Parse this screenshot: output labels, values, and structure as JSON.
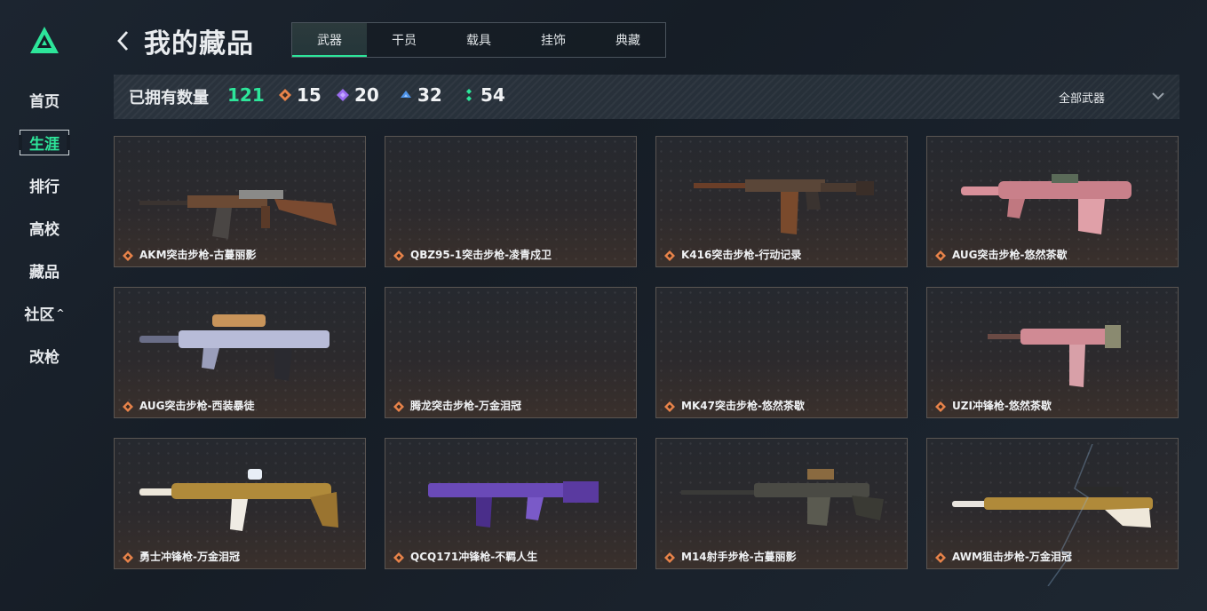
{
  "sidebar": {
    "logo_icon": "triangle-logo",
    "items": [
      {
        "label": "首页",
        "active": false
      },
      {
        "label": "生涯",
        "active": true
      },
      {
        "label": "排行",
        "active": false
      },
      {
        "label": "高校",
        "active": false
      },
      {
        "label": "藏品",
        "active": false
      },
      {
        "label": "社区",
        "active": false,
        "caret": "^"
      },
      {
        "label": "改枪",
        "active": false
      }
    ]
  },
  "header": {
    "title": "我的藏品",
    "back_icon": "chevron-left-icon"
  },
  "tabs": [
    {
      "label": "武器",
      "active": true
    },
    {
      "label": "干员",
      "active": false
    },
    {
      "label": "载具",
      "active": false
    },
    {
      "label": "挂饰",
      "active": false
    },
    {
      "label": "典藏",
      "active": false
    }
  ],
  "stats": {
    "owned_label": "已拥有数量",
    "owned_count": "121",
    "rarities": [
      {
        "count": "15",
        "color": "#e8834a",
        "icon": "orange-diamond-icon"
      },
      {
        "count": "20",
        "color": "#9b6cf0",
        "icon": "purple-diamond-icon"
      },
      {
        "count": "32",
        "color": "#4d93e8",
        "icon": "blue-diamond-icon"
      },
      {
        "count": "54",
        "color": "#2de59a",
        "icon": "green-diamond-icon"
      }
    ],
    "filter_label": "全部武器",
    "filter_icon": "chevron-down-icon"
  },
  "colors": {
    "accent": "#2de59a",
    "rarity_orange": "#e8834a"
  },
  "items": [
    {
      "name": "AKM突击步枪-古蔓丽影",
      "rarity": "orange"
    },
    {
      "name": "QBZ95-1突击步枪-凌青戍卫",
      "rarity": "orange"
    },
    {
      "name": "K416突击步枪-行动记录",
      "rarity": "orange"
    },
    {
      "name": "AUG突击步枪-悠然茶歇",
      "rarity": "orange"
    },
    {
      "name": "AUG突击步枪-西装暴徒",
      "rarity": "orange"
    },
    {
      "name": "腾龙突击步枪-万金泪冠",
      "rarity": "orange"
    },
    {
      "name": "MK47突击步枪-悠然茶歇",
      "rarity": "orange"
    },
    {
      "name": "UZI冲锋枪-悠然茶歇",
      "rarity": "orange"
    },
    {
      "name": "勇士冲锋枪-万金泪冠",
      "rarity": "orange"
    },
    {
      "name": "QCQ171冲锋枪-不羁人生",
      "rarity": "orange"
    },
    {
      "name": "M14射手步枪-古蔓丽影",
      "rarity": "orange"
    },
    {
      "name": "AWM狙击步枪-万金泪冠",
      "rarity": "orange"
    }
  ]
}
